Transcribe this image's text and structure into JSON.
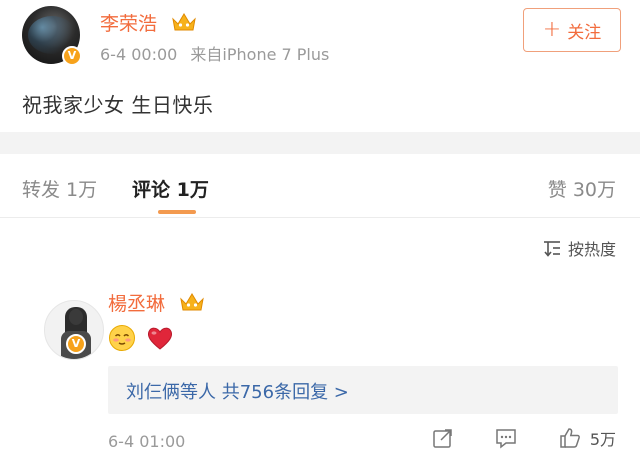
{
  "post": {
    "username": "李荣浩",
    "badge": "V",
    "time": "6-4 00:00",
    "source": "来自iPhone 7 Plus",
    "follow_label": "关注",
    "content": "祝我家少女 生日快乐"
  },
  "tabs": {
    "repost": "转发 1万",
    "comment": "评论 1万",
    "like": "赞 30万"
  },
  "sort_label": "按热度",
  "comment": {
    "username": "楊丞琳",
    "badge": "V",
    "emojis": [
      "blush-emoji",
      "heart-emoji"
    ],
    "reply_summary": "刘仨俩等人  共756条回复 >",
    "time": "6-4 01:00",
    "likes": "5万"
  },
  "colors": {
    "accent": "#f26c3d",
    "link": "#3b68a8",
    "verified": "#f7a21b"
  }
}
